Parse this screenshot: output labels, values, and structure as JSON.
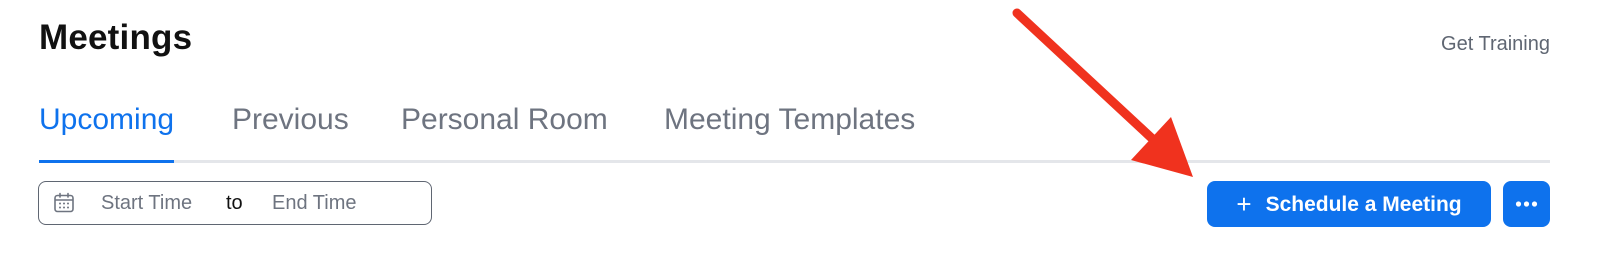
{
  "header": {
    "title": "Meetings",
    "training_link": "Get Training"
  },
  "tabs": [
    {
      "label": "Upcoming",
      "active": true
    },
    {
      "label": "Previous",
      "active": false
    },
    {
      "label": "Personal Room",
      "active": false
    },
    {
      "label": "Meeting Templates",
      "active": false
    }
  ],
  "date_range": {
    "icon": "calendar-icon",
    "start_placeholder": "Start Time",
    "separator": "to",
    "end_placeholder": "End Time"
  },
  "actions": {
    "schedule_icon": "plus-icon",
    "schedule_label": "Schedule a Meeting",
    "more_icon": "ellipsis-icon"
  },
  "annotation": {
    "type": "arrow",
    "color": "#f0321e",
    "target": "schedule-meeting-button"
  },
  "colors": {
    "accent": "#0e72ed",
    "tab_inactive": "#6e7480",
    "divider": "#e4e6ea"
  }
}
